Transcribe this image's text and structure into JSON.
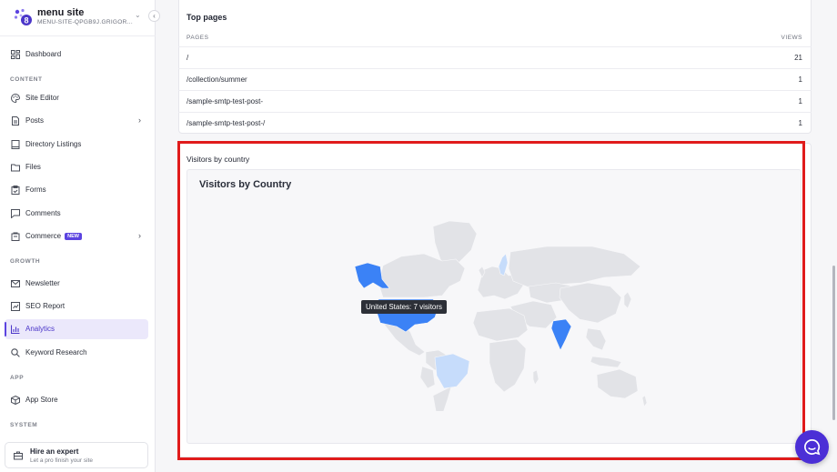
{
  "sidebar": {
    "site_name": "menu site",
    "site_id": "MENU-SITE-QPGB9J.GRIGOR...",
    "sections": {
      "content": "CONTENT",
      "growth": "GROWTH",
      "app": "APP",
      "system": "SYSTEM"
    },
    "items": [
      {
        "label": "Dashboard",
        "icon": "dashboard-icon"
      },
      {
        "label": "Site Editor",
        "icon": "palette-icon"
      },
      {
        "label": "Posts",
        "icon": "document-icon"
      },
      {
        "label": "Directory Listings",
        "icon": "book-icon"
      },
      {
        "label": "Files",
        "icon": "folder-icon"
      },
      {
        "label": "Forms",
        "icon": "clipboard-icon"
      },
      {
        "label": "Comments",
        "icon": "comment-icon"
      },
      {
        "label": "Commerce",
        "icon": "cart-icon",
        "badge": "NEW"
      },
      {
        "label": "Newsletter",
        "icon": "mail-icon"
      },
      {
        "label": "SEO Report",
        "icon": "seo-icon"
      },
      {
        "label": "Analytics",
        "icon": "bar-chart-icon",
        "active": true
      },
      {
        "label": "Keyword Research",
        "icon": "search-icon"
      },
      {
        "label": "App Store",
        "icon": "box-icon"
      }
    ],
    "expert": {
      "title": "Hire an expert",
      "subtitle": "Let a pro finish your site"
    }
  },
  "top_pages": {
    "title": "Top pages",
    "col_pages": "PAGES",
    "col_views": "VIEWS",
    "rows": [
      {
        "path": "/",
        "views": "21"
      },
      {
        "path": "/collection/summer",
        "views": "1"
      },
      {
        "path": "/sample-smtp-test-post-",
        "views": "1"
      },
      {
        "path": "/sample-smtp-test-post-/",
        "views": "1"
      }
    ]
  },
  "visitors": {
    "section_title": "Visitors by country",
    "chart_title": "Visitors by Country",
    "tooltip": "United States: 7 visitors",
    "countries": [
      {
        "country": "United States",
        "visitors": 7
      },
      {
        "country": "India",
        "visitors": 3
      },
      {
        "country": "Brazil",
        "visitors": 1
      },
      {
        "country": "Sweden",
        "visitors": 1
      }
    ],
    "colors": {
      "high": "#3b82f6",
      "low": "#c6dcfb",
      "none": "#e2e3e7"
    }
  }
}
